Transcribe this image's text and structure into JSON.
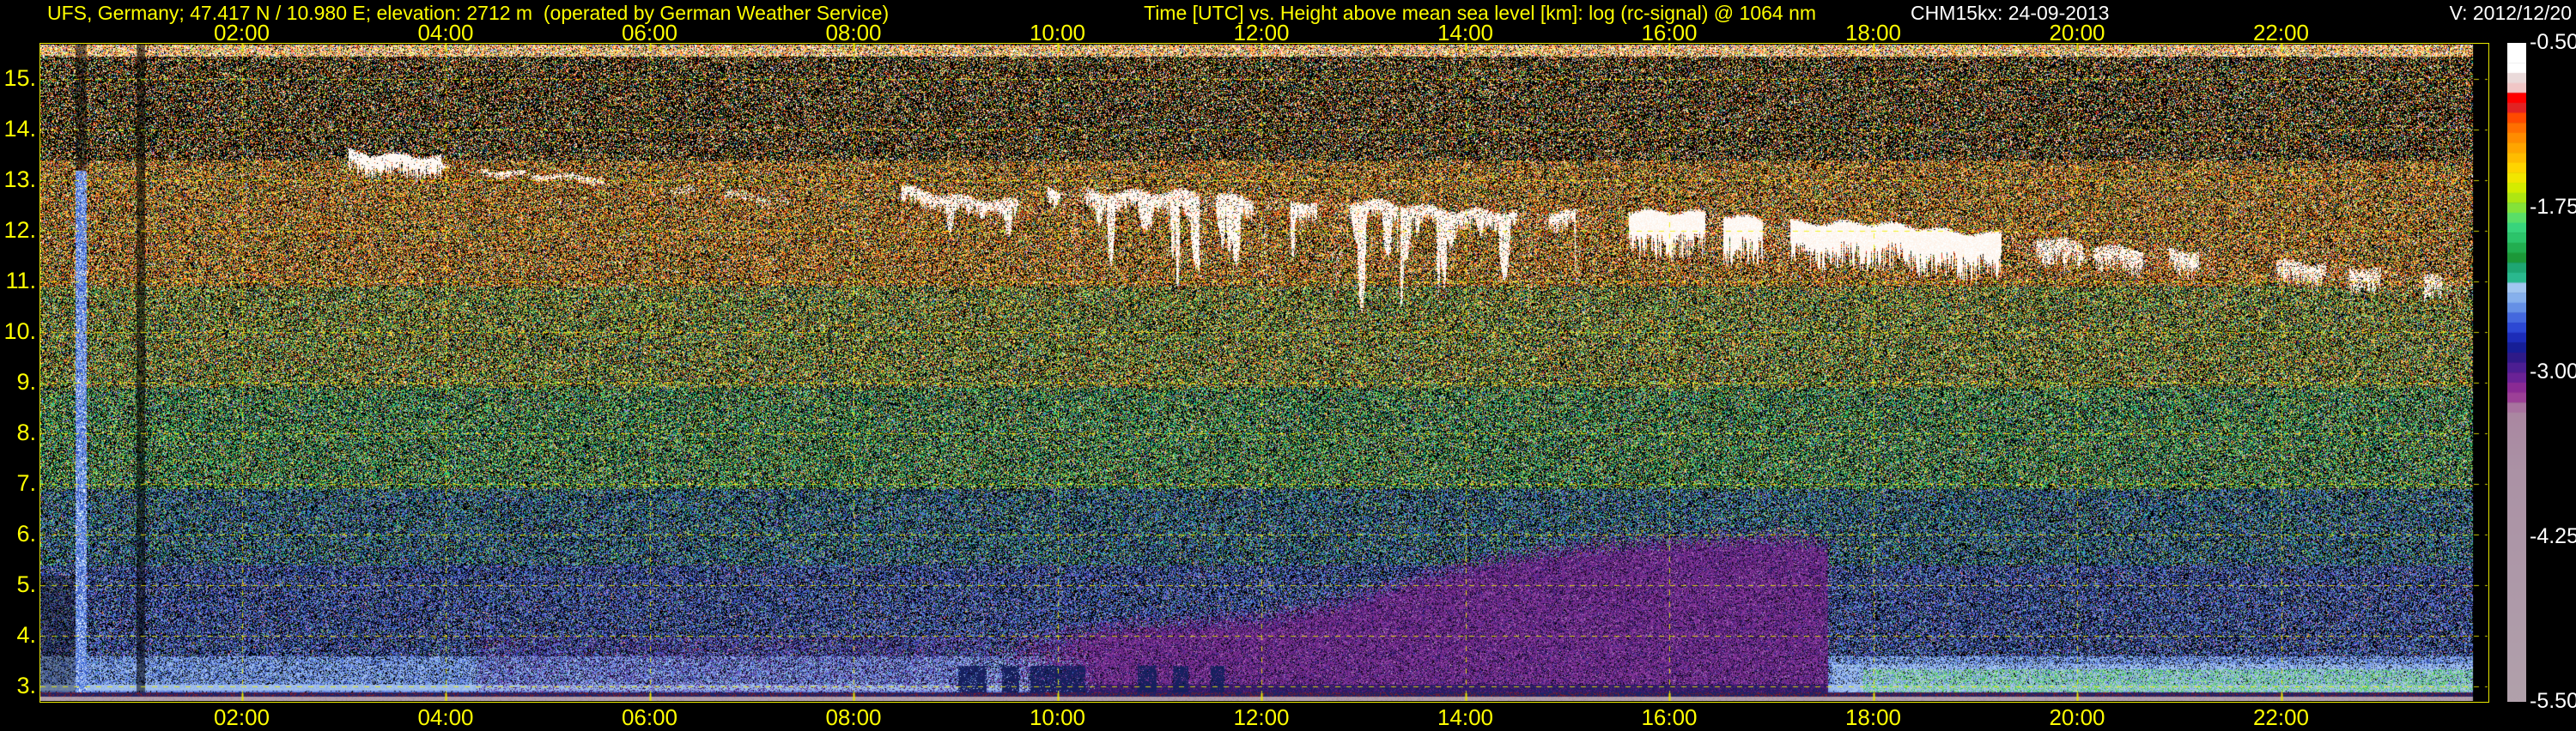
{
  "header": {
    "station": "UFS, Germany; 47.417 N / 10.980 E; elevation: 2712 m  (operated by German Weather Service)",
    "title": "Time [UTC] vs. Height above mean sea level [km]: log (rc-signal) @ 1064 nm",
    "instrument": "CHM15kx: 24-09-2013",
    "version": "V: 2012/12/20"
  },
  "time_axis": {
    "tick_hours": [
      2,
      4,
      6,
      8,
      10,
      12,
      14,
      16,
      18,
      20,
      22
    ],
    "tick_labels": [
      "02:00",
      "04:00",
      "06:00",
      "08:00",
      "10:00",
      "12:00",
      "14:00",
      "16:00",
      "18:00",
      "20:00",
      "22:00"
    ]
  },
  "height_axis": {
    "tick_values": [
      15,
      14,
      13,
      12,
      11,
      10,
      9,
      8,
      7,
      6,
      5,
      4,
      3
    ],
    "tick_labels": [
      "15.",
      "14.",
      "13.",
      "12.",
      "11.",
      "10.",
      "9.",
      "8.",
      "7.",
      "6.",
      "5.",
      "4.",
      "3."
    ]
  },
  "colorbar": {
    "tick_labels": [
      "-0.50",
      "-1.75",
      "-3.00",
      "-4.25",
      "-5.50"
    ],
    "tick_fracs": [
      0,
      0.25,
      0.5,
      0.75,
      1
    ],
    "discrete_frac": 0.561,
    "blocks": [
      "#ffffff",
      "#ffffff",
      "#ffffff",
      "#eadada",
      "#f0c6c6",
      "#ff0000",
      "#e22222",
      "#ff4a00",
      "#ff6f00",
      "#ff8c00",
      "#ffa500",
      "#ffbc00",
      "#ffd400",
      "#f2e600",
      "#d4ec00",
      "#aee612",
      "#84e23a",
      "#5ade68",
      "#38d47c",
      "#2cc46a",
      "#22ae50",
      "#1c9838",
      "#1ea673",
      "#2ab88e",
      "#a2c6f0",
      "#86b0ec",
      "#6590e6",
      "#4468de",
      "#2c48d4",
      "#1c2cb8",
      "#161e96",
      "#2e1a88",
      "#4c1e92",
      "#6a2296",
      "#8a2a94",
      "#9c4097",
      "#a8739f"
    ],
    "tail": [
      [
        0,
        "#aa87a1"
      ],
      [
        0.2,
        "#ab92a5"
      ],
      [
        0.65,
        "#ae9aa9"
      ],
      [
        1,
        "#b1a1ab"
      ]
    ]
  },
  "chart_data": {
    "type": "heatmap",
    "title": "log (rc-signal) @ 1064 nm",
    "x_label": "Time [UTC]",
    "y_label": "Height above mean sea level [km]",
    "x_range_hours": [
      0,
      24
    ],
    "y_range_km": [
      2.71,
      15.69
    ],
    "z_label": "log (rc-signal)",
    "z_range": [
      -5.5,
      -0.5
    ],
    "data_end_hour": 23.87,
    "grid": {
      "x_step_hours": 2,
      "y_step_km": 1,
      "style": "dashed-yellow"
    },
    "noise_bands": [
      {
        "km_hi": 15.69,
        "km_lo": 15.45,
        "d": 0.85,
        "pal": [
          [
            "#ffffff",
            0.22
          ],
          [
            "#ffd27f",
            0.15
          ],
          [
            "#ff9633",
            0.14
          ],
          [
            "#ff4b1e",
            0.1
          ],
          [
            "#ffe94f",
            0.15
          ],
          [
            "#7fd24f",
            0.1
          ],
          [
            "#4f7fe8",
            0.06
          ],
          [
            "#ff8fb4",
            0.08
          ]
        ]
      },
      {
        "km_hi": 15.45,
        "km_lo": 13.4,
        "d": 0.4,
        "pal": [
          [
            "#ff3c1e",
            0.13
          ],
          [
            "#ff7f27",
            0.15
          ],
          [
            "#ffd24f",
            0.15
          ],
          [
            "#ffffff",
            0.12
          ],
          [
            "#59c435",
            0.12
          ],
          [
            "#f4f45f",
            0.09
          ],
          [
            "#3f6fe0",
            0.07
          ],
          [
            "#ff8ab4",
            0.06
          ],
          [
            "#00d2a0",
            0.05
          ],
          [
            "#d0d0d0",
            0.06
          ]
        ]
      },
      {
        "km_hi": 13.4,
        "km_lo": 10.9,
        "d": 0.62,
        "pal": [
          [
            "#ff6a1e",
            0.17
          ],
          [
            "#ffae33",
            0.18
          ],
          [
            "#ffe54f",
            0.15
          ],
          [
            "#e23c1e",
            0.12
          ],
          [
            "#ffffff",
            0.07
          ],
          [
            "#6fbf3f",
            0.14
          ],
          [
            "#3fae6f",
            0.07
          ],
          [
            "#4f6fe0",
            0.05
          ],
          [
            "#ff9ab4",
            0.05
          ]
        ]
      },
      {
        "km_hi": 10.9,
        "km_lo": 8.9,
        "d": 0.6,
        "pal": [
          [
            "#ffb733",
            0.12
          ],
          [
            "#ffe54f",
            0.13
          ],
          [
            "#7fc43f",
            0.2
          ],
          [
            "#3fae5f",
            0.14
          ],
          [
            "#ff6a2e",
            0.09
          ],
          [
            "#ffffff",
            0.05
          ],
          [
            "#2fae8f",
            0.09
          ],
          [
            "#4f6fe0",
            0.08
          ],
          [
            "#e23c3c",
            0.06
          ],
          [
            "#b4f45f",
            0.04
          ]
        ]
      },
      {
        "km_hi": 8.9,
        "km_lo": 6.9,
        "d": 0.58,
        "pal": [
          [
            "#5fbf4f",
            0.2
          ],
          [
            "#2fae6f",
            0.16
          ],
          [
            "#ffe54f",
            0.11
          ],
          [
            "#ffae33",
            0.06
          ],
          [
            "#00c48f",
            0.12
          ],
          [
            "#4f7fe0",
            0.1
          ],
          [
            "#8fd24f",
            0.1
          ],
          [
            "#ffffff",
            0.03
          ],
          [
            "#9f5fd2",
            0.06
          ],
          [
            "#e25f3c",
            0.04
          ]
        ]
      },
      {
        "km_hi": 6.9,
        "km_lo": 5.4,
        "d": 0.56,
        "pal": [
          [
            "#3fae6f",
            0.14
          ],
          [
            "#2f9fae",
            0.09
          ],
          [
            "#4f6fdc",
            0.17
          ],
          [
            "#7fc44f",
            0.1
          ],
          [
            "#e8e84f",
            0.05
          ],
          [
            "#6f8fe8",
            0.12
          ],
          [
            "#2f4fc0",
            0.13
          ],
          [
            "#8f5fd2",
            0.09
          ],
          [
            "#00c4ae",
            0.06
          ],
          [
            "#ff9a3c",
            0.03
          ]
        ]
      },
      {
        "km_hi": 5.4,
        "km_lo": 3.6,
        "d": 0.6,
        "pal": [
          [
            "#4f6fdc",
            0.2
          ],
          [
            "#2f4fc0",
            0.18
          ],
          [
            "#7f9fe8",
            0.15
          ],
          [
            "#3fae8f",
            0.06
          ],
          [
            "#8f5fd2",
            0.1
          ],
          [
            "#1f2f8f",
            0.13
          ],
          [
            "#b49fdc",
            0.05
          ],
          [
            "#5fbf6f",
            0.05
          ],
          [
            "#e8c43c",
            0.02
          ],
          [
            "#ff5f5f",
            0.02
          ]
        ]
      },
      {
        "km_hi": 3.6,
        "km_lo": 3.05,
        "d": 0.8,
        "pal": [
          [
            "#7f9fe8",
            0.3
          ],
          [
            "#9fbfee",
            0.25
          ],
          [
            "#4f6fdc",
            0.2
          ],
          [
            "#2f4fc0",
            0.12
          ],
          [
            "#b4cff4",
            0.1
          ],
          [
            "#3fae8f",
            0.03
          ]
        ]
      },
      {
        "km_hi": 3.05,
        "km_lo": 2.93,
        "d": 1.0,
        "pal": [
          [
            "#a6c2ee",
            0.6
          ],
          [
            "#8fb0e8",
            0.4
          ]
        ]
      },
      {
        "km_hi": 2.93,
        "km_lo": 2.7,
        "d": 0.9,
        "pal": [
          [
            "#7f9fe8",
            0.5
          ],
          [
            "#5f7fdc",
            0.5
          ]
        ]
      }
    ],
    "features": {
      "purple_light": {
        "t": [
          4.3,
          9.33
        ],
        "km_top": 4.0,
        "p": 0.28,
        "pal": [
          [
            "#6f3fa0",
            0.5
          ],
          [
            "#54309e",
            0.25
          ],
          [
            "#1a1040",
            0.25
          ]
        ]
      },
      "purple_region": {
        "t": [
          9.33,
          17.55
        ],
        "ramp_h": 1.5,
        "edge_km": 0.45,
        "base": "#7c2e93",
        "dark_below_km": 3.05,
        "profile": [
          [
            9.33,
            4.1
          ],
          [
            10.5,
            4.4
          ],
          [
            12,
            4.6
          ],
          [
            12.8,
            4.9
          ],
          [
            13.5,
            5.35
          ],
          [
            14.3,
            5.75
          ],
          [
            15.2,
            6.0
          ],
          [
            16.2,
            6.15
          ],
          [
            17.1,
            6.2
          ],
          [
            17.55,
            6.05
          ]
        ],
        "speckles": [
          [
            "#541d6e",
            0.3
          ],
          [
            "#2c2490",
            0.12
          ],
          [
            "#1c1048",
            0.22
          ],
          [
            "#9f4fae",
            0.16
          ],
          [
            "#b48fc4",
            0.06
          ],
          [
            "#000000",
            0.14
          ]
        ],
        "dark_speckles": [
          [
            "#441a6e",
            0.4
          ],
          [
            "#1c2468",
            0.3
          ],
          [
            "#2c1052",
            0.2
          ],
          [
            "#6a2a86",
            0.1
          ]
        ]
      },
      "stripe": {
        "t": [
          0.37,
          0.47
        ],
        "km_split": 13.2,
        "d": 0.95,
        "above_factor": 0.55,
        "pal": [
          [
            "#4f7fe8",
            0.28
          ],
          [
            "#9fbfee",
            0.3
          ],
          [
            "#ffffff",
            0.14
          ],
          [
            "#2f4fc0",
            0.28
          ]
        ]
      },
      "dark_column": {
        "t": [
          0.97,
          1.04
        ],
        "factor": 0.45
      },
      "left_dark": {
        "t_end": 0.37,
        "km_top": 5.2,
        "factor": 0.68
      },
      "right_bottom": {
        "t_start": 17.6,
        "km_top": 3.45,
        "p": 0.5,
        "pal": [
          [
            "#9fc3ee",
            0.5
          ],
          [
            "#b9d4f4",
            0.3
          ],
          [
            "#7f9fe8",
            0.2
          ]
        ]
      },
      "green_patch": {
        "t_start": 17.9,
        "km_top": 3.35,
        "p": 0.4,
        "pal": [
          [
            "#3fc45f",
            0.5
          ],
          [
            "#7fd26f",
            0.3
          ],
          [
            "#b4e88f",
            0.2
          ]
        ]
      },
      "dark_segments": {
        "km_top": 3.42,
        "p": 0.85,
        "color": "#16205e",
        "segments": [
          [
            9.02,
            9.3
          ],
          [
            9.45,
            9.62
          ],
          [
            9.73,
            10.27
          ],
          [
            10.78,
            10.97
          ],
          [
            11.13,
            11.28
          ],
          [
            11.5,
            11.63
          ]
        ]
      },
      "ground": {
        "rows": [
          {
            "y": [
              807,
              812
            ],
            "pal": [
              [
                "#1c2468",
                0.5
              ],
              [
                "#7a1e2e",
                0.3
              ],
              [
                "#2c1c5e",
                0.2
              ]
            ]
          },
          {
            "y": [
              812,
              817
            ],
            "pal": [
              [
                "#b2a0ac",
                0.85
              ],
              [
                "#a4909e",
                0.15
              ]
            ]
          }
        ]
      }
    },
    "clouds": [
      {
        "t": [
          3.05,
          3.95
        ],
        "top": [
          13.62,
          13.45
        ],
        "thick": 0.34,
        "density": 0.95,
        "wav": 0.05,
        "fringe": 0.3,
        "patchy": 0
      },
      {
        "t": [
          3.95,
          5.55
        ],
        "top": [
          13.36,
          13.02
        ],
        "thick": 0.11,
        "density": 0.8,
        "wav": 0.04,
        "fringe": 0.2,
        "patchy": 0.25
      },
      {
        "t": [
          5.9,
          7.35
        ],
        "top": [
          12.98,
          12.62
        ],
        "thick": 0.16,
        "density": 0.45,
        "wav": 0.05,
        "fringe": 0.2,
        "patchy": 0.55
      },
      {
        "t": [
          8.45,
          9.75
        ],
        "top": [
          12.88,
          12.55
        ],
        "thick": 0.26,
        "density": 0.8,
        "wav": 0.05,
        "fringe": 0.3,
        "patchy": 0.3,
        "streaks": {
          "n": 6,
          "len": [
            0.2,
            0.7
          ],
          "w": [
            5,
            12
          ]
        }
      },
      {
        "t": [
          9.9,
          15.35
        ],
        "top": [
          12.88,
          12.32
        ],
        "thick": 0.3,
        "density": 0.85,
        "wav": 0.06,
        "fringe": 0.35,
        "patchy": 0.35,
        "streaks": {
          "n": 40,
          "len": [
            0.4,
            2.1
          ],
          "w": [
            5,
            16
          ]
        }
      },
      {
        "t": [
          15.6,
          19.25
        ],
        "top": [
          12.42,
          11.98
        ],
        "thick": 0.7,
        "density": 1.0,
        "wav": 0.05,
        "fringe": 0.4,
        "patchy": 0.12,
        "streaks": {
          "n": 18,
          "len": [
            0.15,
            0.6
          ],
          "w": [
            6,
            14
          ]
        }
      },
      {
        "t": [
          19.35,
          21.35
        ],
        "top": [
          11.92,
          11.55
        ],
        "thick": 0.4,
        "density": 0.75,
        "wav": 0.06,
        "fringe": 0.35,
        "patchy": 0.5,
        "streaks": {
          "n": 10,
          "len": [
            0.15,
            0.5
          ],
          "w": [
            5,
            12
          ]
        }
      },
      {
        "t": [
          21.95,
          23.82
        ],
        "top": [
          11.42,
          11.08
        ],
        "thick": 0.36,
        "density": 0.7,
        "wav": 0.06,
        "fringe": 0.3,
        "patchy": 0.5,
        "streaks": {
          "n": 8,
          "len": [
            0.1,
            0.4
          ],
          "w": [
            5,
            10
          ]
        }
      }
    ]
  }
}
